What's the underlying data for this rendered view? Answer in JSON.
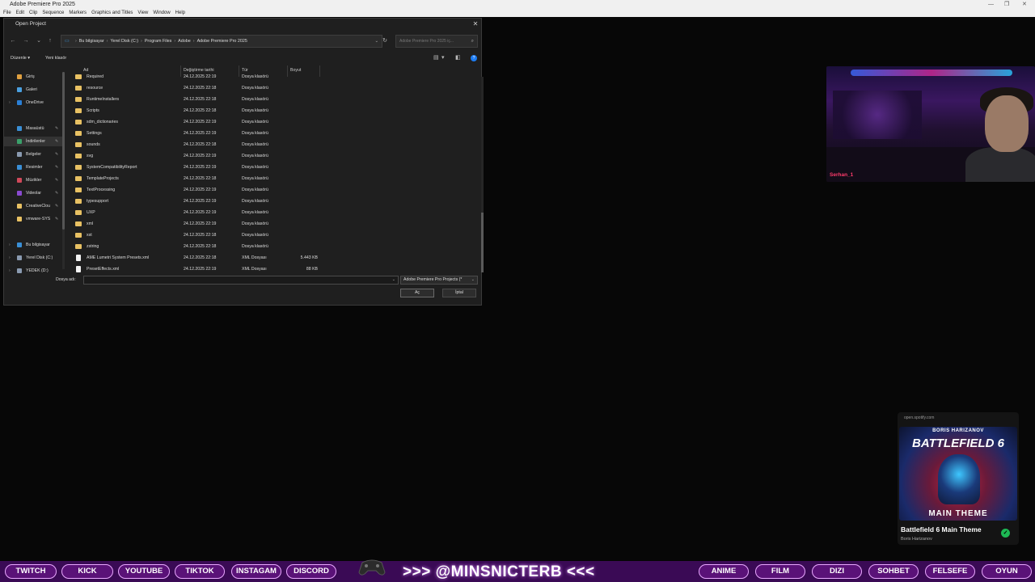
{
  "app": {
    "title": "Adobe Premiere Pro 2025",
    "menu": [
      "File",
      "Edit",
      "Clip",
      "Sequence",
      "Markers",
      "Graphics and Titles",
      "View",
      "Window",
      "Help"
    ]
  },
  "dialog": {
    "title": "Open Project",
    "breadcrumb": [
      "Bu bilgisayar",
      "Yerel Disk (C:)",
      "Program Files",
      "Adobe",
      "Adobe Premiere Pro 2025"
    ],
    "search_placeholder": "Adobe Premiere Pro 2025 iç...",
    "toolbar": {
      "organize": "Düzenle ▾",
      "new_folder": "Yeni klasör"
    },
    "sidebar": [
      {
        "label": "Giriş",
        "icon": "home-icon",
        "color": "#e0a040",
        "pinned": false,
        "chev": false
      },
      {
        "label": "Galeri",
        "icon": "gallery-icon",
        "color": "#4aa0e0",
        "pinned": false,
        "chev": false
      },
      {
        "label": "OneDrive",
        "icon": "cloud-icon",
        "color": "#2a7fd6",
        "pinned": false,
        "chev": true
      },
      {
        "label": "Masaüstü",
        "icon": "desktop-icon",
        "color": "#3a8fd6",
        "pinned": true,
        "chev": false
      },
      {
        "label": "İndirilenler",
        "icon": "download-icon",
        "color": "#3aa06a",
        "pinned": true,
        "chev": false,
        "selected": true
      },
      {
        "label": "Belgeler",
        "icon": "documents-icon",
        "color": "#8a9ab0",
        "pinned": true,
        "chev": false
      },
      {
        "label": "Resimler",
        "icon": "pictures-icon",
        "color": "#3a8fd6",
        "pinned": true,
        "chev": false
      },
      {
        "label": "Müzikler",
        "icon": "music-icon",
        "color": "#d0485a",
        "pinned": true,
        "chev": false
      },
      {
        "label": "Videolar",
        "icon": "videos-icon",
        "color": "#8a4ad0",
        "pinned": true,
        "chev": false
      },
      {
        "label": "CreativeClou",
        "icon": "folder-icon",
        "color": "#e8c163",
        "pinned": true,
        "chev": false
      },
      {
        "label": "vmware-SYS",
        "icon": "folder-icon",
        "color": "#e8c163",
        "pinned": true,
        "chev": false
      },
      {
        "label": "Bu bilgisayar",
        "icon": "computer-icon",
        "color": "#3a8fd6",
        "pinned": false,
        "chev": true
      },
      {
        "label": "Yerel Disk (C:)",
        "icon": "drive-icon",
        "color": "#8a9ab0",
        "pinned": false,
        "chev": true
      },
      {
        "label": "YEDEK (D:)",
        "icon": "drive-icon",
        "color": "#8a9ab0",
        "pinned": false,
        "chev": true
      }
    ],
    "columns": {
      "name": "Ad",
      "modified": "Değiştirme tarihi",
      "type": "Tür",
      "size": "Boyut"
    },
    "files": [
      {
        "name": "Required",
        "date": "24.12.2025 22:19",
        "type": "Dosya klasörü",
        "size": "",
        "kind": "folder"
      },
      {
        "name": "resource",
        "date": "24.12.2025 22:18",
        "type": "Dosya klasörü",
        "size": "",
        "kind": "folder"
      },
      {
        "name": "RuntimeInstallers",
        "date": "24.12.2025 22:18",
        "type": "Dosya klasörü",
        "size": "",
        "kind": "folder"
      },
      {
        "name": "Scripts",
        "date": "24.12.2025 22:18",
        "type": "Dosya klasörü",
        "size": "",
        "kind": "folder"
      },
      {
        "name": "sdm_dictionaries",
        "date": "24.12.2025 22:19",
        "type": "Dosya klasörü",
        "size": "",
        "kind": "folder"
      },
      {
        "name": "Settings",
        "date": "24.12.2025 22:19",
        "type": "Dosya klasörü",
        "size": "",
        "kind": "folder"
      },
      {
        "name": "sounds",
        "date": "24.12.2025 22:18",
        "type": "Dosya klasörü",
        "size": "",
        "kind": "folder"
      },
      {
        "name": "svg",
        "date": "24.12.2025 22:19",
        "type": "Dosya klasörü",
        "size": "",
        "kind": "folder"
      },
      {
        "name": "SystemCompatibilityReport",
        "date": "24.12.2025 22:19",
        "type": "Dosya klasörü",
        "size": "",
        "kind": "folder"
      },
      {
        "name": "TemplateProjects",
        "date": "24.12.2025 22:18",
        "type": "Dosya klasörü",
        "size": "",
        "kind": "folder"
      },
      {
        "name": "TextProcessing",
        "date": "24.12.2025 22:19",
        "type": "Dosya klasörü",
        "size": "",
        "kind": "folder"
      },
      {
        "name": "typesupport",
        "date": "24.12.2025 22:19",
        "type": "Dosya klasörü",
        "size": "",
        "kind": "folder"
      },
      {
        "name": "UXP",
        "date": "24.12.2025 22:19",
        "type": "Dosya klasörü",
        "size": "",
        "kind": "folder"
      },
      {
        "name": "xml",
        "date": "24.12.2025 22:19",
        "type": "Dosya klasörü",
        "size": "",
        "kind": "folder"
      },
      {
        "name": "xst",
        "date": "24.12.2025 22:18",
        "type": "Dosya klasörü",
        "size": "",
        "kind": "folder"
      },
      {
        "name": "zstring",
        "date": "24.12.2025 22:18",
        "type": "Dosya klasörü",
        "size": "",
        "kind": "folder"
      },
      {
        "name": "AME Lumetri System Presets.xml",
        "date": "24.12.2025 22:18",
        "type": "XML Dosyası",
        "size": "5.443 KB",
        "kind": "file"
      },
      {
        "name": "PresetEffects.xml",
        "date": "24.12.2025 22:19",
        "type": "XML Dosyası",
        "size": "88 KB",
        "kind": "file"
      }
    ],
    "filename_label": "Dosya adı:",
    "filename_value": "",
    "filetype": "Adobe Premiere Pro Projects (*",
    "open_label": "Aç",
    "cancel_label": "İptal"
  },
  "webcam": {
    "name_tag": "Serhan_1"
  },
  "spotify": {
    "url": "open.spotify.com",
    "art_artist": "BORIS HARIZANOV",
    "art_title": "BATTLEFIELD 6",
    "art_subtitle": "MAIN THEME",
    "track": "Battlefield 6 Main Theme",
    "artist": "Boris Harizanov"
  },
  "stream_bar": {
    "left_buttons": [
      "TWITCH",
      "KICK",
      "YOUTUBE",
      "TIKTOK",
      "INSTAGAM",
      "DISCORD"
    ],
    "handle": ">>> @MINSNICTERB <<<",
    "right_buttons": [
      "ANIME",
      "FILM",
      "DIZI",
      "SOHBET",
      "FELSEFE",
      "OYUN"
    ]
  }
}
